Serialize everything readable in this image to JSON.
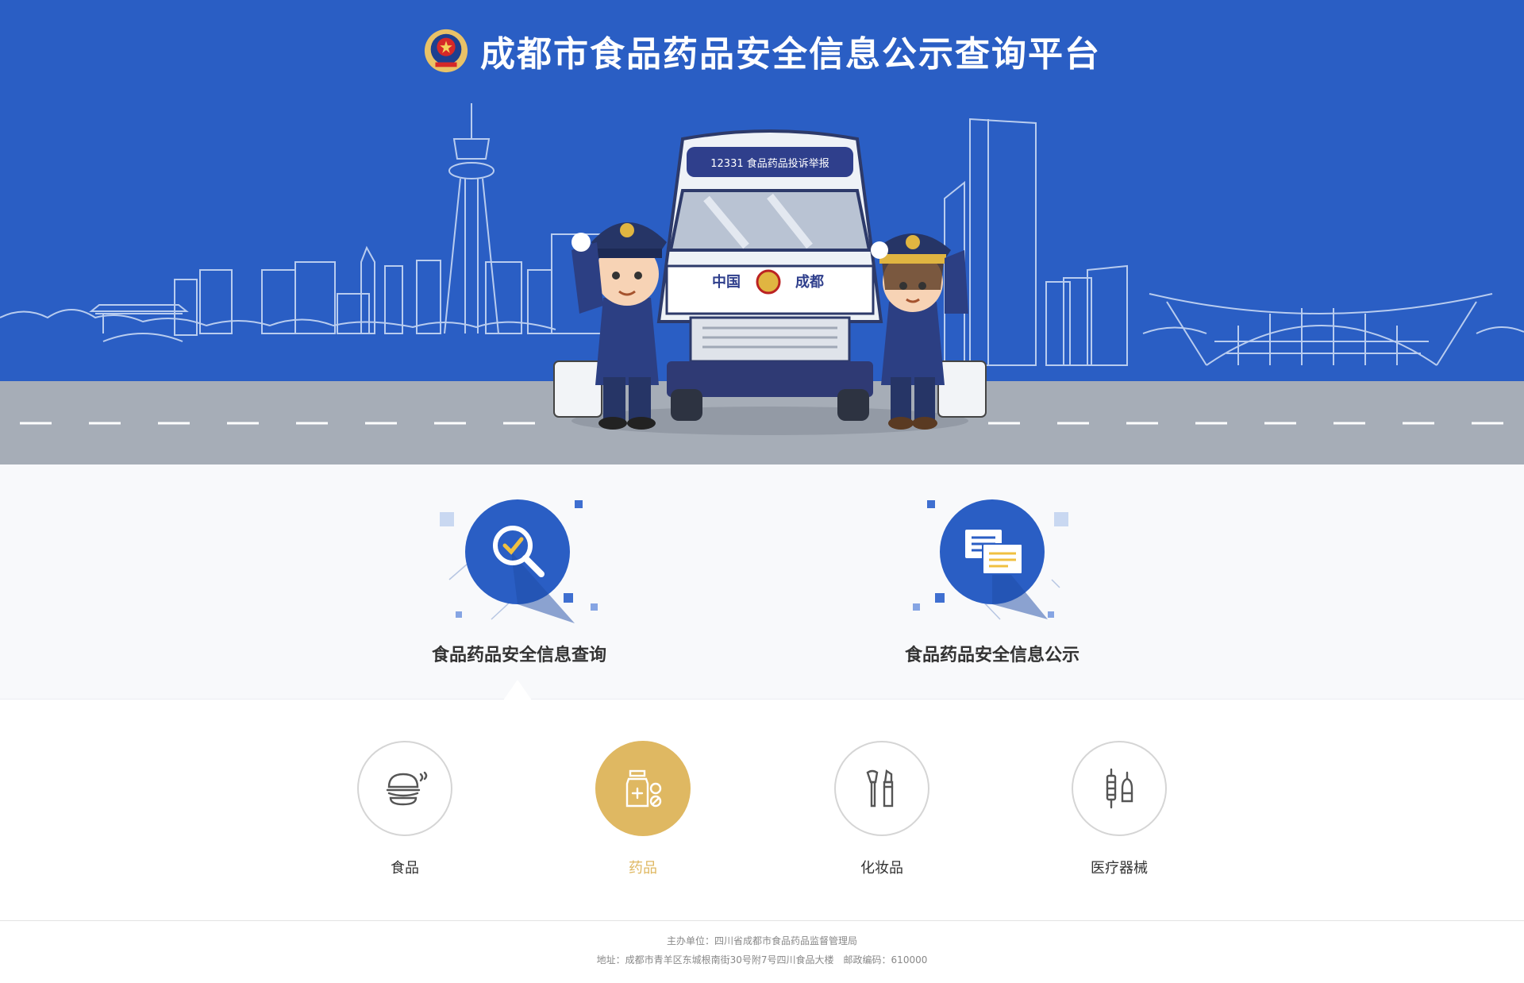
{
  "header": {
    "title": "成都市食品药品安全信息公示查询平台",
    "emblem_icon": "police-emblem-icon"
  },
  "hero": {
    "van_top_text": "12331 食品药品投诉举报",
    "van_front_left": "中国",
    "van_front_right": "成都",
    "illustration": "inspectors-saluting-beside-van"
  },
  "services": [
    {
      "label": "食品药品安全信息查询",
      "icon": "magnifier-check-icon",
      "active": true
    },
    {
      "label": "食品药品安全信息公示",
      "icon": "documents-icon",
      "active": false
    }
  ],
  "categories": [
    {
      "label": "食品",
      "icon": "burger-icon",
      "active": false
    },
    {
      "label": "药品",
      "icon": "medicine-bottle-icon",
      "active": true
    },
    {
      "label": "化妆品",
      "icon": "cosmetics-brush-icon",
      "active": false
    },
    {
      "label": "医疗器械",
      "icon": "medical-device-icon",
      "active": false
    }
  ],
  "footer": {
    "line1": "主办单位：四川省成都市食品药品监督管理局",
    "line2": "地址：成都市青羊区东城根南街30号附7号四川食品大楼　邮政编码：610000"
  },
  "colors": {
    "hero_blue": "#2a5ec4",
    "road_gray": "#a6adb7",
    "accent_gold": "#dfb862",
    "service_icon_blue": "#2a5ec4"
  }
}
